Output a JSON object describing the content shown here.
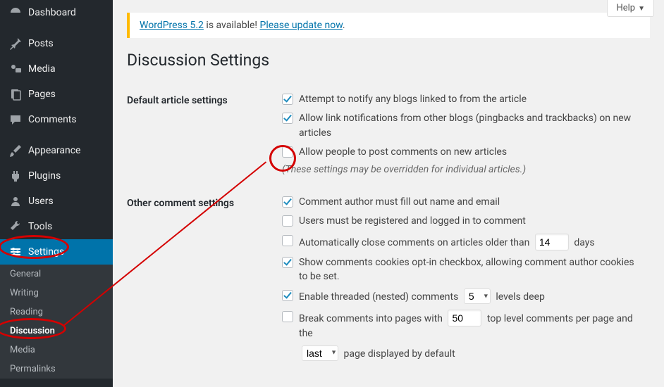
{
  "help": {
    "label": "Help"
  },
  "sidebar": {
    "items": [
      {
        "label": "Dashboard"
      },
      {
        "label": "Posts"
      },
      {
        "label": "Media"
      },
      {
        "label": "Pages"
      },
      {
        "label": "Comments"
      },
      {
        "label": "Appearance"
      },
      {
        "label": "Plugins"
      },
      {
        "label": "Users"
      },
      {
        "label": "Tools"
      },
      {
        "label": "Settings"
      }
    ],
    "sub": [
      {
        "label": "General"
      },
      {
        "label": "Writing"
      },
      {
        "label": "Reading"
      },
      {
        "label": "Discussion"
      },
      {
        "label": "Media"
      },
      {
        "label": "Permalinks"
      }
    ]
  },
  "nag": {
    "link1": "WordPress 5.2",
    "mid": " is available! ",
    "link2": "Please update now",
    "tail": "."
  },
  "page_title": "Discussion Settings",
  "sections": {
    "default": {
      "heading": "Default article settings",
      "opt1": "Attempt to notify any blogs linked to from the article",
      "opt2": "Allow link notifications from other blogs (pingbacks and trackbacks) on new articles",
      "opt3": "Allow people to post comments on new articles",
      "note": "(These settings may be overridden for individual articles.)"
    },
    "other": {
      "heading": "Other comment settings",
      "opt1": "Comment author must fill out name and email",
      "opt2": "Users must be registered and logged in to comment",
      "opt3_pre": "Automatically close comments on articles older than",
      "opt3_days_val": "14",
      "opt3_post": "days",
      "opt4": "Show comments cookies opt-in checkbox, allowing comment author cookies to be set.",
      "opt5_pre": "Enable threaded (nested) comments",
      "opt5_sel": "5",
      "opt5_post": "levels deep",
      "opt6_pre": "Break comments into pages with",
      "opt6_val": "50",
      "opt6_mid": "top level comments per page and the",
      "opt6_sel": "last",
      "opt6_post": "page displayed by default"
    }
  }
}
